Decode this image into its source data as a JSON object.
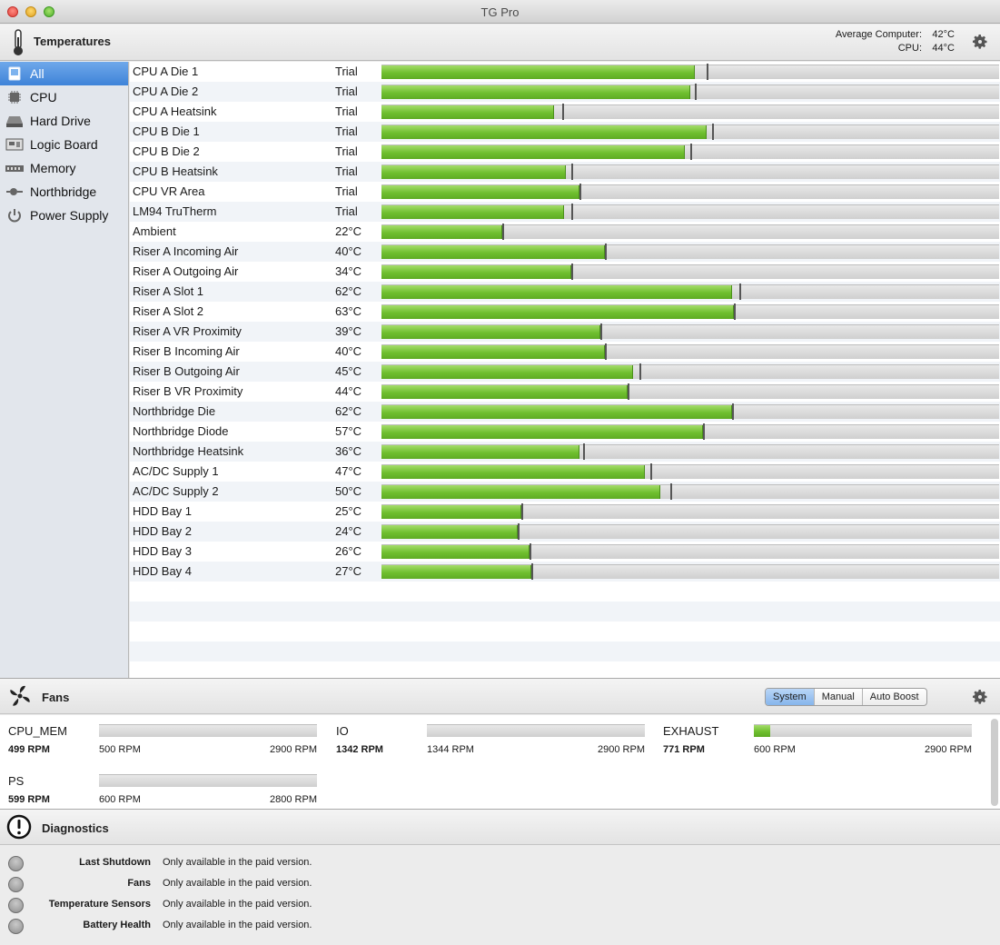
{
  "window": {
    "title": "TG Pro"
  },
  "temperatures": {
    "title": "Temperatures",
    "avg_label": "Average Computer:",
    "avg_value": "42°C",
    "cpu_label": "CPU:",
    "cpu_value": "44°C"
  },
  "sidebar": {
    "items": [
      {
        "label": "All",
        "icon": "all-icon",
        "active": true
      },
      {
        "label": "CPU",
        "icon": "cpu-icon"
      },
      {
        "label": "Hard Drive",
        "icon": "hard-drive-icon"
      },
      {
        "label": "Logic Board",
        "icon": "logic-board-icon"
      },
      {
        "label": "Memory",
        "icon": "memory-icon"
      },
      {
        "label": "Northbridge",
        "icon": "northbridge-icon"
      },
      {
        "label": "Power Supply",
        "icon": "power-icon"
      }
    ]
  },
  "sensors": [
    {
      "name": "CPU A Die 1",
      "value": "Trial",
      "level": 0.508,
      "max": 0.527
    },
    {
      "name": "CPU A Die 2",
      "value": "Trial",
      "level": 0.5,
      "max": 0.508
    },
    {
      "name": "CPU A Heatsink",
      "value": "Trial",
      "level": 0.28,
      "max": 0.292
    },
    {
      "name": "CPU B Die 1",
      "value": "Trial",
      "level": 0.527,
      "max": 0.536
    },
    {
      "name": "CPU B Die 2",
      "value": "Trial",
      "level": 0.491,
      "max": 0.5
    },
    {
      "name": "CPU B Heatsink",
      "value": "Trial",
      "level": 0.298,
      "max": 0.308
    },
    {
      "name": "CPU VR Area",
      "value": "Trial",
      "level": 0.321,
      "max": 0.321
    },
    {
      "name": "LM94 TruTherm",
      "value": "Trial",
      "level": 0.296,
      "max": 0.308
    },
    {
      "name": "Ambient",
      "value": "22°C",
      "level": 0.196,
      "max": 0.196
    },
    {
      "name": "Riser A Incoming Air",
      "value": "40°C",
      "level": 0.362,
      "max": 0.362
    },
    {
      "name": "Riser A Outgoing Air",
      "value": "34°C",
      "level": 0.308,
      "max": 0.308
    },
    {
      "name": "Riser A Slot 1",
      "value": "62°C",
      "level": 0.567,
      "max": 0.58
    },
    {
      "name": "Riser A Slot 2",
      "value": "63°C",
      "level": 0.571,
      "max": 0.571
    },
    {
      "name": "Riser A VR Proximity",
      "value": "39°C",
      "level": 0.354,
      "max": 0.354
    },
    {
      "name": "Riser B Incoming Air",
      "value": "40°C",
      "level": 0.362,
      "max": 0.362
    },
    {
      "name": "Riser B Outgoing Air",
      "value": "45°C",
      "level": 0.408,
      "max": 0.417
    },
    {
      "name": "Riser B VR Proximity",
      "value": "44°C",
      "level": 0.399,
      "max": 0.399
    },
    {
      "name": "Northbridge Die",
      "value": "62°C",
      "level": 0.567,
      "max": 0.567
    },
    {
      "name": "Northbridge Diode",
      "value": "57°C",
      "level": 0.521,
      "max": 0.521
    },
    {
      "name": "Northbridge Heatsink",
      "value": "36°C",
      "level": 0.321,
      "max": 0.327
    },
    {
      "name": "AC/DC Supply 1",
      "value": "47°C",
      "level": 0.427,
      "max": 0.436
    },
    {
      "name": "AC/DC Supply 2",
      "value": "50°C",
      "level": 0.452,
      "max": 0.467
    },
    {
      "name": "HDD Bay 1",
      "value": "25°C",
      "level": 0.227,
      "max": 0.227
    },
    {
      "name": "HDD Bay 2",
      "value": "24°C",
      "level": 0.22,
      "max": 0.22
    },
    {
      "name": "HDD Bay 3",
      "value": "26°C",
      "level": 0.239,
      "max": 0.239
    },
    {
      "name": "HDD Bay 4",
      "value": "27°C",
      "level": 0.243,
      "max": 0.243
    }
  ],
  "fans": {
    "title": "Fans",
    "modes": [
      "System",
      "Manual",
      "Auto Boost"
    ],
    "active_mode": "System",
    "items": [
      {
        "name": "CPU_MEM",
        "rpm": "499 RPM",
        "min": "500 RPM",
        "max": "2900 RPM",
        "level": 0.0
      },
      {
        "name": "IO",
        "rpm": "1342 RPM",
        "min": "1344 RPM",
        "max": "2900 RPM",
        "level": 0.0
      },
      {
        "name": "EXHAUST",
        "rpm": "771 RPM",
        "min": "600 RPM",
        "max": "2900 RPM",
        "level": 0.074
      },
      {
        "name": "PS",
        "rpm": "599 RPM",
        "min": "600 RPM",
        "max": "2800 RPM",
        "level": 0.0
      }
    ]
  },
  "diagnostics": {
    "title": "Diagnostics",
    "items": [
      {
        "label": "Last Shutdown",
        "value": "Only available in the paid version."
      },
      {
        "label": "Fans",
        "value": "Only available in the paid version."
      },
      {
        "label": "Temperature Sensors",
        "value": "Only available in the paid version."
      },
      {
        "label": "Battery Health",
        "value": "Only available in the paid version."
      }
    ]
  },
  "colors": {
    "accent": "#3e83d8",
    "bar_green": "#6fbf2f",
    "track": "#d8d8d8"
  }
}
